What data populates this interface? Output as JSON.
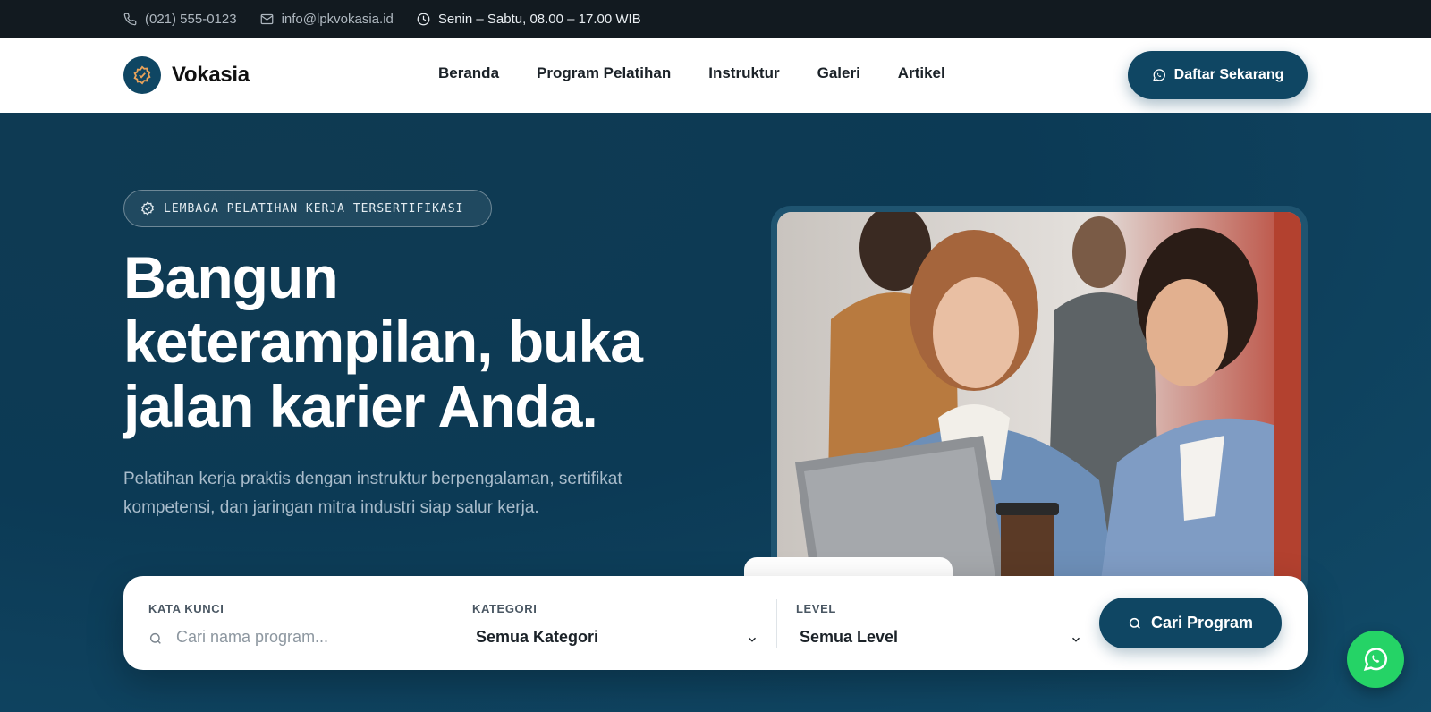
{
  "topbar": {
    "phone": "(021) 555-0123",
    "email": "info@lpkvokasia.id",
    "hours": "Senin – Sabtu, 08.00 – 17.00 WIB",
    "icons": [
      "phone-icon",
      "mail-icon",
      "clock-icon"
    ]
  },
  "nav": {
    "brand": "Vokasia",
    "items": [
      {
        "label": "Beranda"
      },
      {
        "label": "Program Pelatihan"
      },
      {
        "label": "Instruktur"
      },
      {
        "label": "Galeri"
      },
      {
        "label": "Artikel"
      }
    ],
    "cta_label": "Daftar Sekarang"
  },
  "hero": {
    "badge": "LEMBAGA PELATIHAN KERJA TERSERTIFIKASI",
    "headline": "Bangun keterampilan, buka jalan karier Anda.",
    "subtext": "Pelatihan kerja praktis dengan instruktur berpengalaman, sertifikat kompetensi, dan jaringan mitra industri siap salur kerja."
  },
  "search": {
    "keyword_label": "KATA KUNCI",
    "keyword_placeholder": "Cari nama program...",
    "category_label": "KATEGORI",
    "category_value": "Semua Kategori",
    "level_label": "LEVEL",
    "level_value": "Semua Level",
    "button_label": "Cari Program"
  },
  "colors": {
    "brand": "#0f4663",
    "topbar": "#121a20",
    "whatsapp": "#25d366"
  }
}
